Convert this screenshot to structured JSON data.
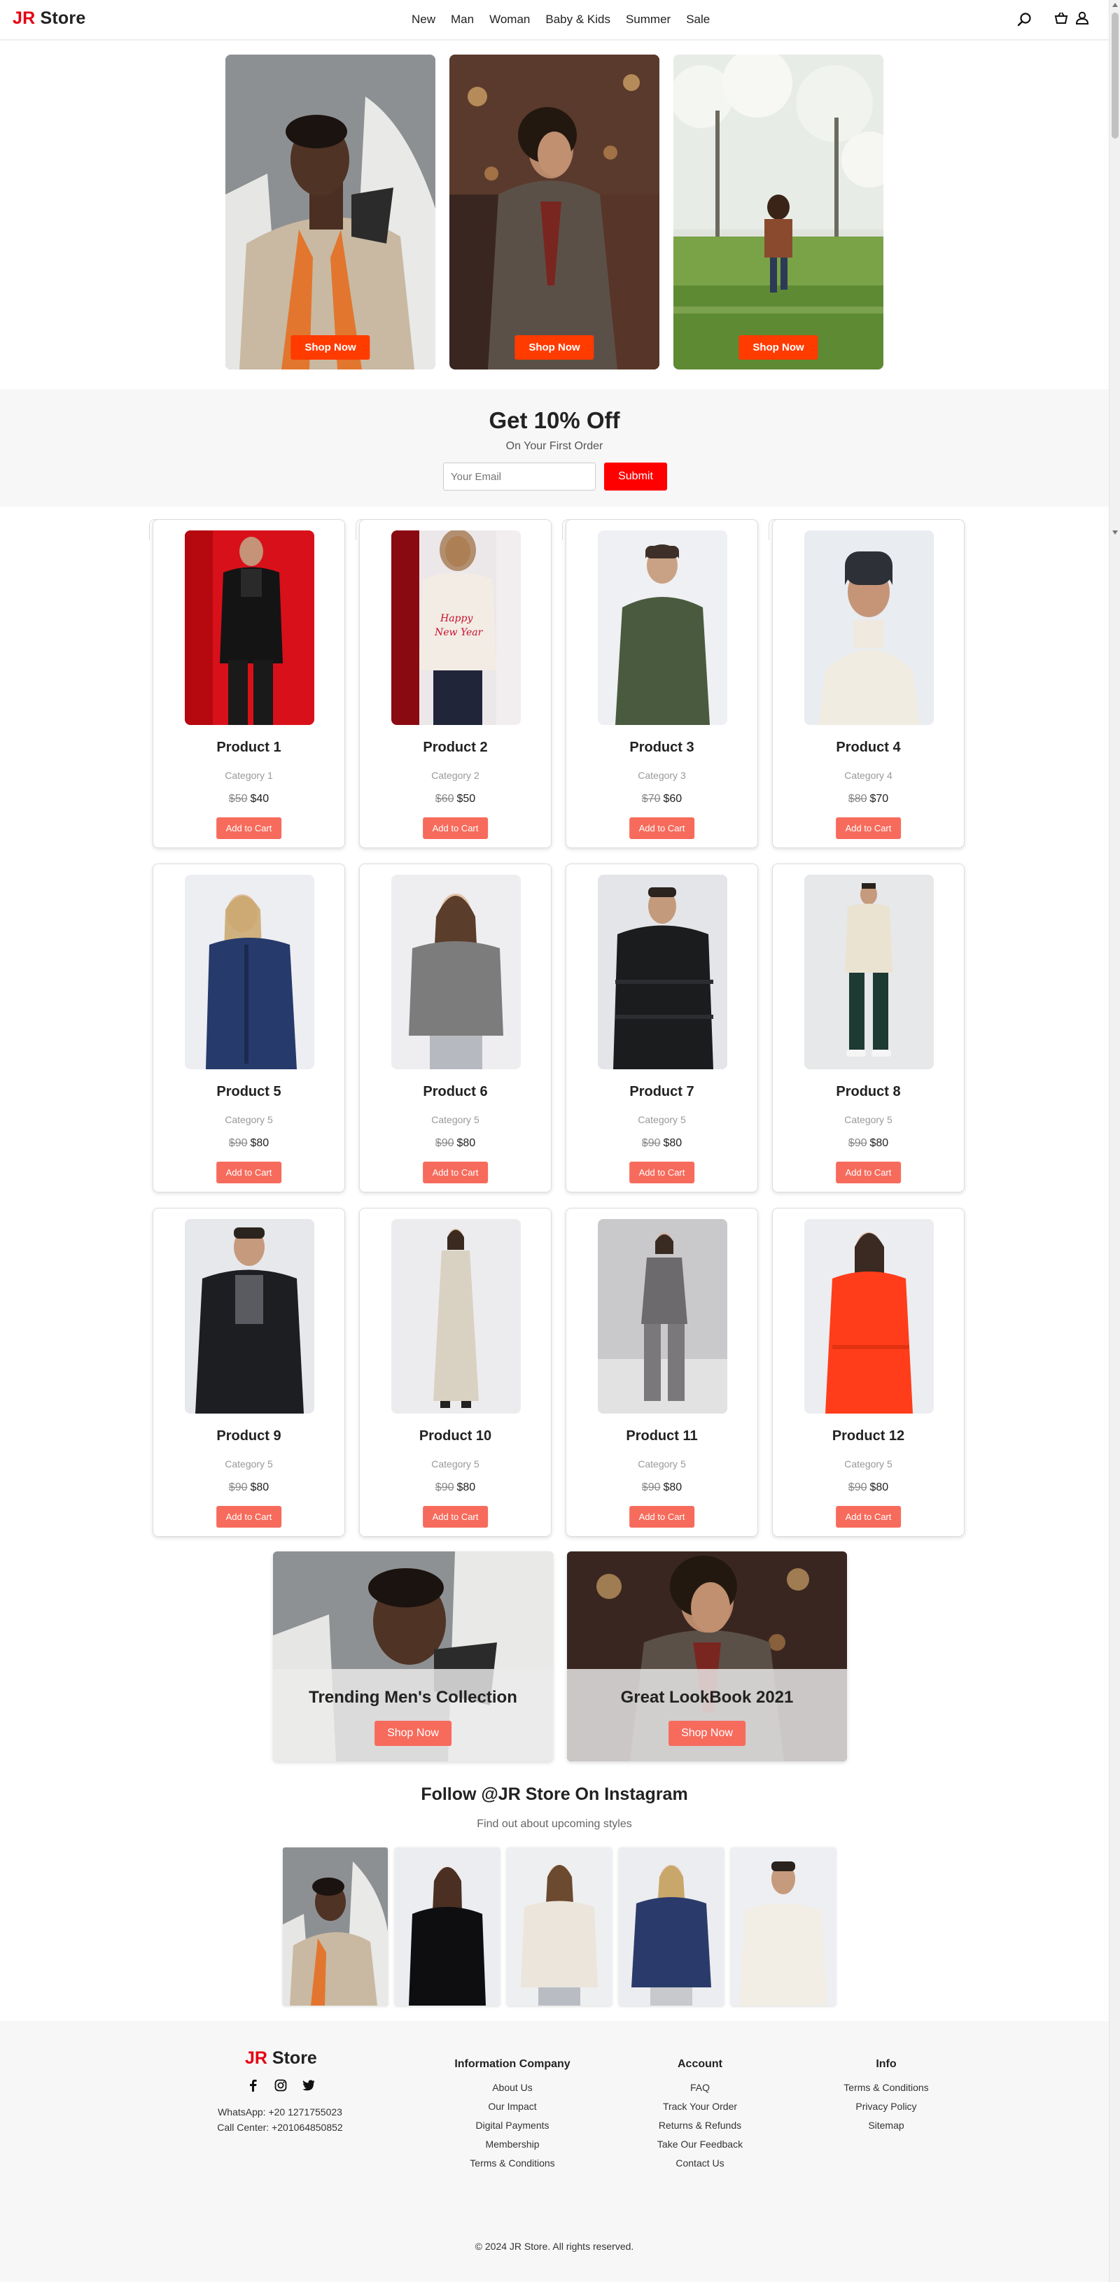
{
  "header": {
    "logo_jr": "JR",
    "logo_store": "Store",
    "nav": [
      "New",
      "Man",
      "Woman",
      "Baby & Kids",
      "Summer",
      "Sale"
    ],
    "icons": [
      "search-icon",
      "basket-icon",
      "user-icon"
    ]
  },
  "hero": {
    "cards": [
      {
        "button": "Shop Now"
      },
      {
        "button": "Shop Now"
      },
      {
        "button": "Shop Now"
      }
    ]
  },
  "promo": {
    "title": "Get 10% Off",
    "subtitle": "On Your First Order",
    "email_placeholder": "Your Email",
    "submit": "Submit"
  },
  "products": [
    {
      "name": "Product 1",
      "category": "Category 1",
      "old_price": "$50",
      "price": "$40",
      "button": "Add to Cart"
    },
    {
      "name": "Product 2",
      "category": "Category 2",
      "old_price": "$60",
      "price": "$50",
      "button": "Add to Cart"
    },
    {
      "name": "Product 3",
      "category": "Category 3",
      "old_price": "$70",
      "price": "$60",
      "button": "Add to Cart"
    },
    {
      "name": "Product 4",
      "category": "Category 4",
      "old_price": "$80",
      "price": "$70",
      "button": "Add to Cart"
    },
    {
      "name": "Product 5",
      "category": "Category 5",
      "old_price": "$90",
      "price": "$80",
      "button": "Add to Cart"
    },
    {
      "name": "Product 6",
      "category": "Category 5",
      "old_price": "$90",
      "price": "$80",
      "button": "Add to Cart"
    },
    {
      "name": "Product 7",
      "category": "Category 5",
      "old_price": "$90",
      "price": "$80",
      "button": "Add to Cart"
    },
    {
      "name": "Product 8",
      "category": "Category 5",
      "old_price": "$90",
      "price": "$80",
      "button": "Add to Cart"
    },
    {
      "name": "Product 9",
      "category": "Category 5",
      "old_price": "$90",
      "price": "$80",
      "button": "Add to Cart"
    },
    {
      "name": "Product 10",
      "category": "Category 5",
      "old_price": "$90",
      "price": "$80",
      "button": "Add to Cart"
    },
    {
      "name": "Product 11",
      "category": "Category 5",
      "old_price": "$90",
      "price": "$80",
      "button": "Add to Cart"
    },
    {
      "name": "Product 12",
      "category": "Category 5",
      "old_price": "$90",
      "price": "$80",
      "button": "Add to Cart"
    }
  ],
  "banners": [
    {
      "title": "Trending Men's Collection",
      "button": "Shop Now"
    },
    {
      "title": "Great LookBook 2021",
      "button": "Shop Now"
    }
  ],
  "instagram": {
    "title": "Follow @JR Store On Instagram",
    "subtitle": "Find out about upcoming styles"
  },
  "footer": {
    "logo_jr": "JR",
    "logo_store": "Store",
    "social_icons": [
      "facebook-icon",
      "instagram-icon",
      "twitter-icon"
    ],
    "whatsapp": "WhatsApp: +20 1271755023",
    "call_center": "Call Center: +201064850852",
    "columns": [
      {
        "title": "Information Company",
        "links": [
          "About Us",
          "Our Impact",
          "Digital Payments",
          "Membership",
          "Terms & Conditions"
        ]
      },
      {
        "title": "Account",
        "links": [
          "FAQ",
          "Track Your Order",
          "Returns & Refunds",
          "Take Our Feedback",
          "Contact Us"
        ]
      },
      {
        "title": "Info",
        "links": [
          "Terms & Conditions",
          "Privacy Policy",
          "Sitemap"
        ]
      }
    ],
    "copyright": "© 2024 JR Store. All rights reserved."
  },
  "colors": {
    "accent": "#ff3b00",
    "brand": "#e60012",
    "cart_button": "#f76b5c",
    "submit": "#ff0000"
  }
}
